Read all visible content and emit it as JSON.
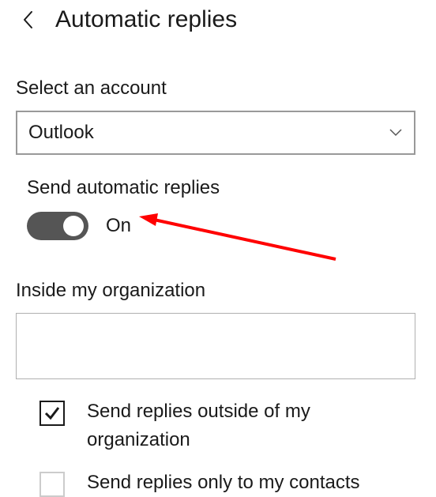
{
  "header": {
    "title": "Automatic replies"
  },
  "account": {
    "label": "Select an account",
    "selected": "Outlook"
  },
  "toggle": {
    "label": "Send automatic replies",
    "state": "On"
  },
  "inside": {
    "label": "Inside my organization",
    "value": ""
  },
  "checkboxes": {
    "outside": {
      "label": "Send replies outside of my organization",
      "checked": true
    },
    "contacts": {
      "label": "Send replies only to my contacts",
      "checked": false
    }
  }
}
